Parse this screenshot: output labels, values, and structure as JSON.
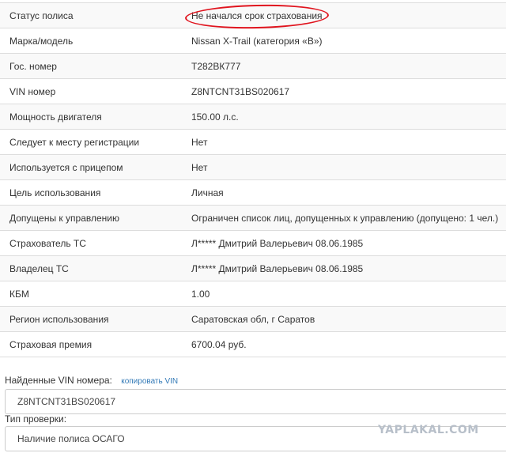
{
  "policy_info": {
    "rows": [
      {
        "label": "Статус полиса",
        "value": "Не начался срок страхования"
      },
      {
        "label": "Марка/модель",
        "value": "Nissan X-Trail (категория «B»)"
      },
      {
        "label": "Гос. номер",
        "value": "Т282ВК777"
      },
      {
        "label": "VIN номер",
        "value": "Z8NTCNT31BS020617"
      },
      {
        "label": "Мощность двигателя",
        "value": "150.00 л.с."
      },
      {
        "label": "Следует к месту регистрации",
        "value": "Нет"
      },
      {
        "label": "Используется с прицепом",
        "value": "Нет"
      },
      {
        "label": "Цель использования",
        "value": "Личная"
      },
      {
        "label": "Допущены к управлению",
        "value": "Ограничен список лиц, допущенных к управлению (допущено: 1 чел.)"
      },
      {
        "label": "Страхователь ТС",
        "value": "Л***** Дмитрий Валерьевич 08.06.1985"
      },
      {
        "label": "Владелец ТС",
        "value": "Л***** Дмитрий Валерьевич 08.06.1985"
      },
      {
        "label": "КБМ",
        "value": "1.00"
      },
      {
        "label": "Регион использования",
        "value": "Саратовская обл, г Саратов"
      },
      {
        "label": "Страховая премия",
        "value": "6700.04 руб."
      }
    ]
  },
  "vin_section": {
    "label": "Найденные VIN номера:",
    "copy_link": "копировать VIN",
    "value": "Z8NTCNT31BS020617"
  },
  "check_type": {
    "label": "Тип проверки:",
    "value": "Наличие полиса ОСАГО"
  },
  "watermark": "YAPLAKAL.COM",
  "colors": {
    "highlight_oval": "#e0141e",
    "link": "#337ab7",
    "row_stripe": "#f9f9f9"
  }
}
